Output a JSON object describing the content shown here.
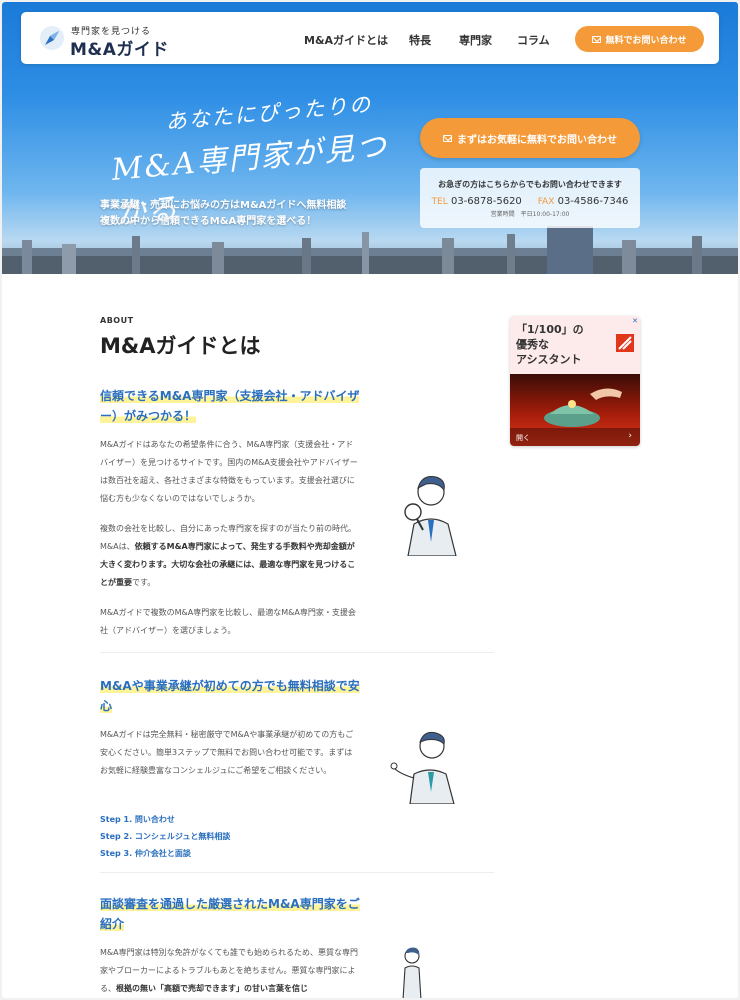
{
  "header": {
    "logo_sub": "専門家を見つける",
    "logo_main": "M&Aガイド",
    "nav": [
      "M&Aガイドとは",
      "特長",
      "専門家",
      "コラム"
    ],
    "cta": "無料でお問い合わせ"
  },
  "hero": {
    "catch_line1": "あなたにぴったりの",
    "catch_line2": "M&A専門家が見つかる",
    "lead_line1": "事業承継・売却にお悩みの方はM&Aガイドへ無料相談",
    "lead_line2": "複数の中から信頼できるM&A専門家を選べる！",
    "cta": "まずはお気軽に無料でお問い合わせ",
    "contact_title": "お急ぎの方はこちらからでもお問い合わせできます",
    "tel_label": "TEL",
    "tel": "03-6878-5620",
    "fax_label": "FAX",
    "fax": "03-4586-7346",
    "hours": "営業時間　平日10:00-17:00"
  },
  "about": {
    "eyebrow": "ABOUT",
    "title": "M&Aガイドとは",
    "blocks": [
      {
        "heading": "信頼できるM&A専門家（支援会社・アドバイザー）がみつかる！",
        "p1": "M&Aガイドはあなたの希望条件に合う、M&A専門家（支援会社・アドバイザー）を見つけるサイトです。国内のM&A支援会社やアドバイザーは数百社を超え、各社さまざまな特徴をもっています。支援会社選びに悩む方も少なくないのではないでしょうか。",
        "p2_a": "複数の会社を比較し、自分にあった専門家を探すのが当たり前の時代。M&Aは、",
        "p2_b": "依頼するM&A専門家によって、発生する手数料や売却金額が大きく変わります。大切な会社の承継には、最適な専門家を見つけることが重要",
        "p2_c": "です。",
        "p3": "M&Aガイドで複数のM&A専門家を比較し、最適なM&A専門家・支援会社（アドバイザー）を選びましょう。"
      },
      {
        "heading": "M&Aや事業承継が初めての方でも無料相談で安心",
        "p1": "M&Aガイドは完全無料・秘密厳守でM&Aや事業承継が初めての方もご安心ください。簡単3ステップで無料でお問い合わせ可能です。まずはお気軽に経験豊富なコンシェルジュにご希望をご相談ください。",
        "steps": [
          "Step 1. 問い合わせ",
          "Step 2. コンシェルジュと無料相談",
          "Step 3. 仲介会社と面談"
        ]
      },
      {
        "heading": "面談審査を通過した厳選されたM&A専門家をご紹介",
        "p1_a": "M&A専門家は特別な免許がなくても誰でも始められるため、悪質な専門家やブローカーによるトラブルもあとを絶ちません。悪質な専門家による、",
        "p1_b": "根拠の無い「高額で売却できます」の甘い言葉を信じ"
      }
    ]
  },
  "ad": {
    "line1": "「1/100」の",
    "line2": "優秀な",
    "line3": "アシスタント",
    "open_label": "開く",
    "accent": "#e0361a"
  },
  "colors": {
    "orange": "#f49a38",
    "blue": "#2a6fbf",
    "highlight": "#fff39a"
  }
}
